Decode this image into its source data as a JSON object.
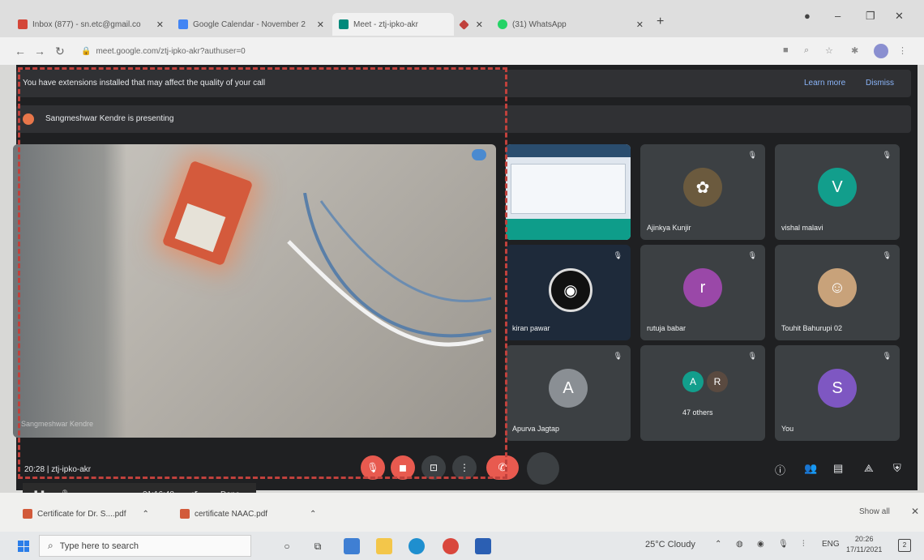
{
  "browser": {
    "tabs": [
      {
        "title": "Inbox (877) - sn.etc@gmail.co",
        "favicon_color": "#d44638"
      },
      {
        "title": "Google Calendar - November 2",
        "favicon_color": "#4285f4"
      },
      {
        "title": "Meet - ztj-ipko-akr",
        "favicon_color": "#00897b"
      },
      {
        "title": "",
        "favicon_color": "#c0413c"
      },
      {
        "title": "(31) WhatsApp",
        "favicon_color": "#25d366"
      }
    ],
    "new_tab_label": "+",
    "url": "meet.google.com/ztj-ipko-akr?authuser=0"
  },
  "meet": {
    "banner_text": "You have extensions installed that may affect the quality of your call",
    "learn_more": "Learn more",
    "dismiss": "Dismiss",
    "presenting_text": "Sangmeshwar Kendre is presenting",
    "main_video_name": "Sangmeshwar Kendre",
    "participants": [
      {
        "name": "",
        "kind": "screen"
      },
      {
        "name": "Ajinkya Kunjir",
        "kind": "photo",
        "color": "#6b5a3e"
      },
      {
        "name": "vishal malavi",
        "kind": "initial",
        "initial": "V",
        "color": "#129e8c"
      },
      {
        "name": "kiran pawar",
        "kind": "logo",
        "color": "#1e2a3a"
      },
      {
        "name": "rutuja babar",
        "kind": "initial",
        "initial": "r",
        "color": "#9a48a8"
      },
      {
        "name": "Touhit Bahurupi 02",
        "kind": "photo",
        "color": "#c8a27a"
      },
      {
        "name": "Apurva Jagtap",
        "kind": "initial",
        "initial": "A",
        "color": "#8a8f94"
      },
      {
        "name": "47 others",
        "kind": "group",
        "initial": "A",
        "initial2": "R",
        "color": "#129e8c",
        "color2": "#5a4a40"
      },
      {
        "name": "You",
        "kind": "initial",
        "initial": "S",
        "color": "#7e57c2"
      }
    ],
    "time": "20:28",
    "meeting_code": "ztj-ipko-akr"
  },
  "recording": {
    "time": "21:16:48",
    "done": "Done"
  },
  "downloads": {
    "items": [
      "Certificate for Dr. S....pdf",
      "certificate NAAC.pdf"
    ],
    "show_all": "Show all"
  },
  "taskbar": {
    "search_placeholder": "Type here to search",
    "weather": "25°C  Cloudy",
    "lang": "ENG",
    "time": "20:26",
    "date": "17/11/2021",
    "notifications": "2"
  }
}
